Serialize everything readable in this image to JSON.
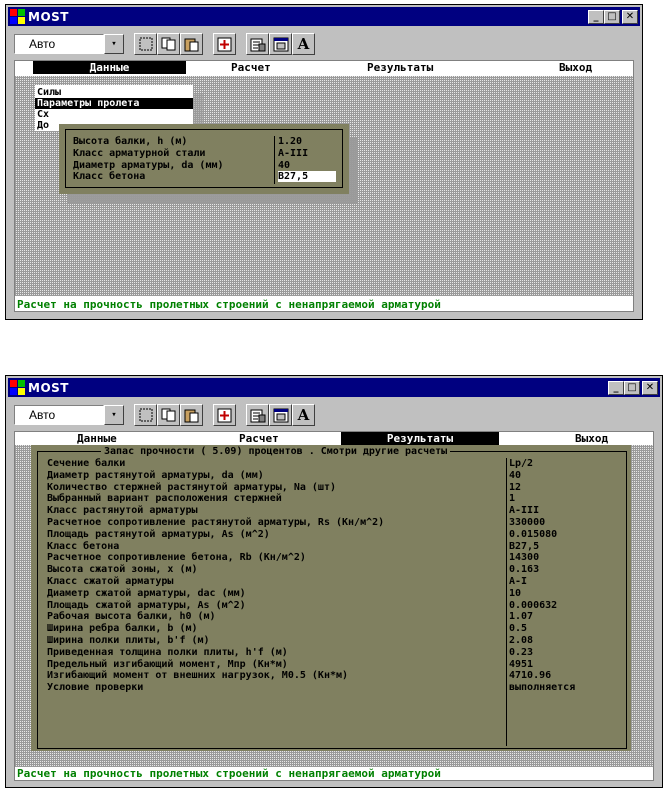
{
  "window_title": "MOST",
  "toolbar": {
    "combo_value": "Авто",
    "combo_arrow": "▾",
    "font_button": "A"
  },
  "menu": {
    "data": "Данные",
    "calc": "Расчет",
    "results": "Результаты",
    "exit": "Выход"
  },
  "status": "Расчет на прочность пролетных строений с ненапрягаемой арматурой",
  "screen1": {
    "submenu": [
      "Силы",
      "Параметры пролета",
      "Сх",
      "До"
    ],
    "params": [
      {
        "label": "Высота балки, h (м)",
        "value": "1.20"
      },
      {
        "label": "Класс арматурной стали",
        "value": "A-III"
      },
      {
        "label": "Диаметр арматуры, da (мм)",
        "value": "40"
      },
      {
        "label": "Класс бетона",
        "value": "B27,5"
      }
    ]
  },
  "screen2": {
    "results_title": "Запас прочности (  5.09) процентов . Смотри другие расчеты",
    "results": [
      {
        "label": "Сечение балки",
        "value": "Lp/2"
      },
      {
        "label": "Диаметр растянутой арматуры, da (мм)",
        "value": "40"
      },
      {
        "label": "Количество стержней растянутой арматуры, Na (шт)",
        "value": "12"
      },
      {
        "label": "Выбранный вариант расположения стержней",
        "value": "1"
      },
      {
        "label": "Класс растянутой арматуры",
        "value": "A-III"
      },
      {
        "label": "Расчетное сопротивление растянутой арматуры, Rs (Кн/м^2)",
        "value": "330000"
      },
      {
        "label": "Площадь растянутой арматуры, As (м^2)",
        "value": "0.015080"
      },
      {
        "label": "Класс бетона",
        "value": "B27,5"
      },
      {
        "label": "Расчетное сопротивление бетона, Rb (Кн/м^2)",
        "value": "14300"
      },
      {
        "label": "Высота сжатой зоны, x (м)",
        "value": "0.163"
      },
      {
        "label": "Класс сжатой арматуры",
        "value": "A-I"
      },
      {
        "label": "Диаметр сжатой арматуры, dac (мм)",
        "value": "10"
      },
      {
        "label": "Площадь сжатой арматуры, As (м^2)",
        "value": "0.000632"
      },
      {
        "label": "Рабочая высота балки, h0 (м)",
        "value": "1.07"
      },
      {
        "label": "Ширина ребра балки, b (м)",
        "value": "0.5"
      },
      {
        "label": "Ширина полки плиты, b'f (м)",
        "value": "2.08"
      },
      {
        "label": "Приведенная толщина полки плиты, h'f (м)",
        "value": "0.23"
      },
      {
        "label": "Предельный изгибающий момент, Mпр (Кн*м)",
        "value": "4951"
      },
      {
        "label": "Изгибающий момент от внешних нагрузок, M0.5 (Кн*м)",
        "value": "4710.96"
      },
      {
        "label": "Условие проверки",
        "value": "выполняется"
      }
    ]
  }
}
